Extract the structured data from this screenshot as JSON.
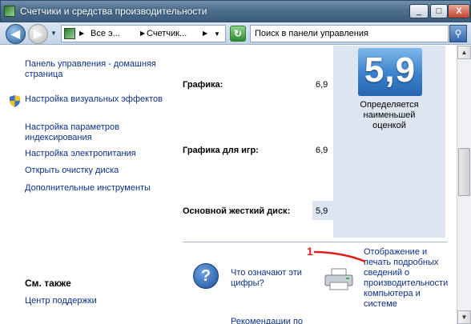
{
  "window": {
    "title": "Счетчики и средства производительности",
    "min_label": "_",
    "max_label": "□",
    "close_label": "X"
  },
  "nav": {
    "back_glyph": "◀",
    "forward_glyph": "▶",
    "breadcrumbs": [
      "Все э...",
      "Счетчик..."
    ],
    "crumb_separator": "▶",
    "address_dropdown": "▼",
    "go_glyph": "↻",
    "search_placeholder": "Поиск в панели управления",
    "search_glyph": "⚲"
  },
  "sidebar": {
    "items": [
      {
        "label": "Панель управления - домашняя страница",
        "icon": null
      },
      {
        "label": "Настройка визуальных эффектов",
        "icon": "shield-icon"
      },
      {
        "label": "Настройка параметров индексирования",
        "icon": null
      },
      {
        "label": "Настройка электропитания",
        "icon": null
      },
      {
        "label": "Открыть очистку диска",
        "icon": null
      },
      {
        "label": "Дополнительные инструменты",
        "icon": null
      }
    ],
    "see_also_title": "См. также",
    "see_also_items": [
      "Центр поддержки"
    ]
  },
  "scores": {
    "rows": [
      {
        "label": "Графика:",
        "value": "6,9"
      },
      {
        "label": "Графика для игр:",
        "value": "6,9"
      },
      {
        "label": "Основной жесткий диск:",
        "value": "5,9"
      }
    ],
    "base_score": "5,9",
    "base_score_note": "Определяется наименьшей оценкой"
  },
  "links": {
    "help": "Что означают эти цифры?",
    "print": "Отображение и печать подробных сведений о производительности компьютера и системе",
    "recommendations": "Рекомендации по"
  },
  "annotation": {
    "number": "1",
    "color": "#e21b1b"
  },
  "scrollbar": {
    "up_glyph": "▲",
    "down_glyph": "▼"
  }
}
